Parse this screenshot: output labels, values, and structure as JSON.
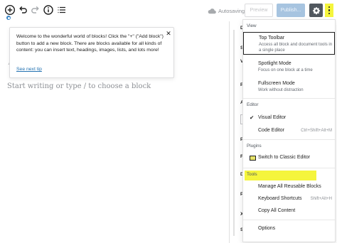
{
  "toolbar": {
    "add_block_icon": "plus-circle-icon",
    "undo_icon": "undo-icon",
    "redo_icon": "redo-icon",
    "info_icon": "info-icon",
    "outline_icon": "list-view-icon",
    "status": "Autosaving",
    "preview_label": "Preview",
    "publish_label": "Publish...",
    "settings_icon": "gear-icon",
    "more_icon": "more-vertical-icon"
  },
  "tip": {
    "text": "Welcome to the wonderful world of blocks! Click the \"+\" (\"Add block\") button to add a new block. There are blocks available for all kinds of content: you can insert text, headings, images, lists, and lots more!",
    "link": "See next tip",
    "close_icon": "close-icon"
  },
  "editor": {
    "placeholder": "Start writing or type / to choose a block"
  },
  "sidebar_peek": {
    "labels": [
      "D",
      "S",
      "V",
      "P",
      "A",
      "P",
      "Fe",
      "D",
      "P",
      "X",
      "Sl"
    ]
  },
  "menu": {
    "view": {
      "title": "View",
      "items": [
        {
          "label": "Top Toolbar",
          "desc": "Access all block and document tools in a single place",
          "selected": true
        },
        {
          "label": "Spotlight Mode",
          "desc": "Focus on one block at a time"
        },
        {
          "label": "Fullscreen Mode",
          "desc": "Work without distraction"
        }
      ]
    },
    "editor": {
      "title": "Editor",
      "items": [
        {
          "label": "Visual Editor",
          "checked": true,
          "check_icon": "check-icon"
        },
        {
          "label": "Code Editor",
          "shortcut": "Ctrl+Shift+Alt+M"
        }
      ]
    },
    "plugins": {
      "title": "Plugins",
      "items": [
        {
          "label": "Switch to Classic Editor",
          "icon": "classic-editor-icon",
          "highlight_color": "#f5f53c"
        }
      ]
    },
    "tools": {
      "title": "Tools",
      "items": [
        {
          "label": "Manage All Reusable Blocks"
        },
        {
          "label": "Keyboard Shortcuts",
          "shortcut": "Shift+Alt+H"
        },
        {
          "label": "Copy All Content"
        }
      ]
    },
    "options": {
      "label": "Options"
    }
  },
  "colors": {
    "accent": "#2271b1",
    "highlight": "#f5f53c",
    "settings_button": "#50575e",
    "publish_disabled": "#a7c4e0"
  }
}
